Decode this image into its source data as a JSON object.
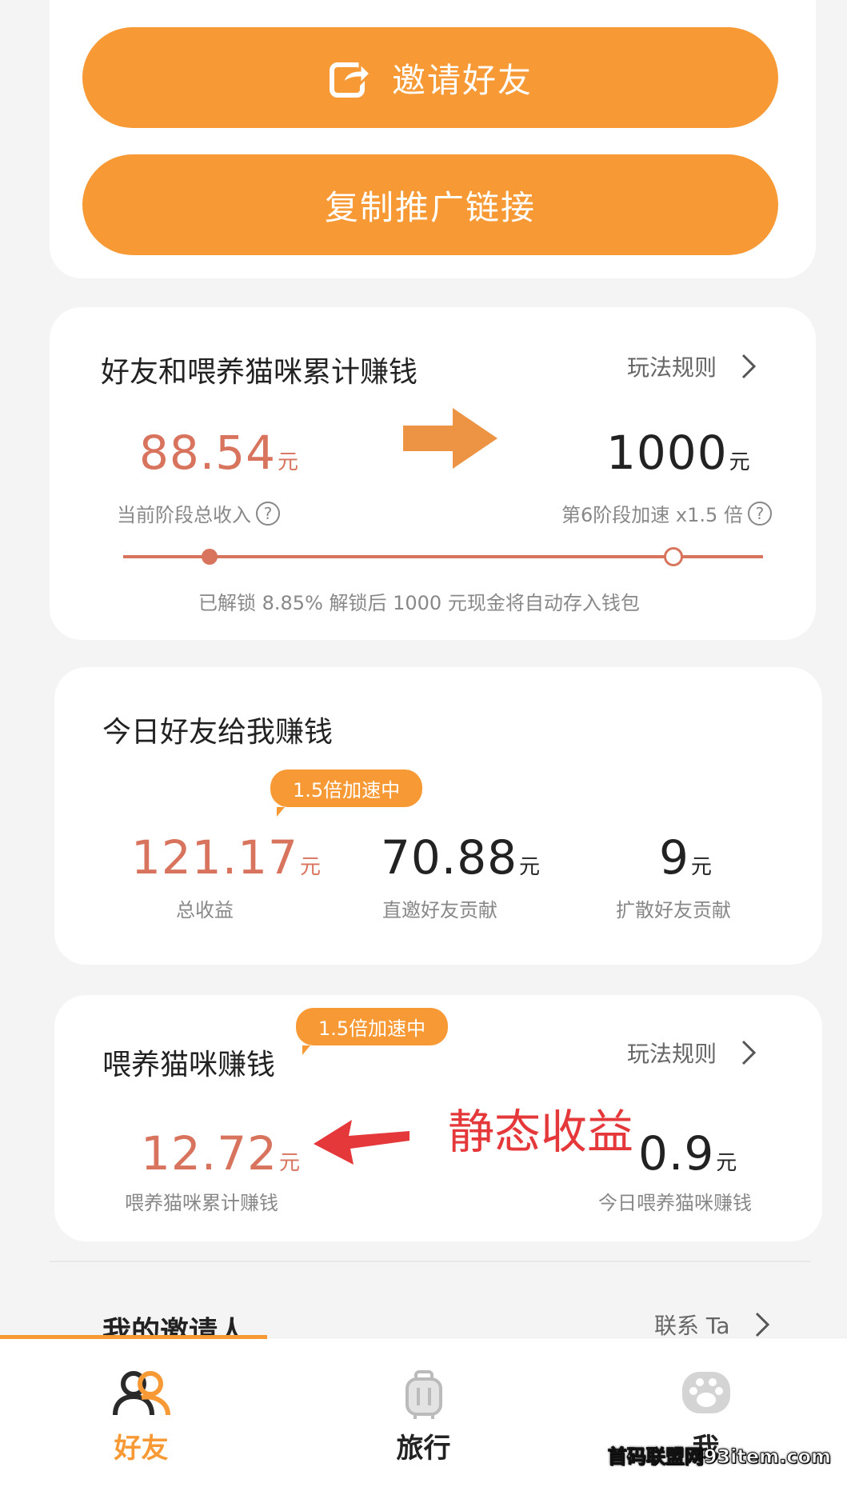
{
  "actions": {
    "invite_label": "邀请好友",
    "copy_link_label": "复制推广链接"
  },
  "cumulative": {
    "title": "好友和喂养猫咪累计赚钱",
    "rules_label": "玩法规则",
    "current_amount": "88.54",
    "current_unit": "元",
    "current_caption": "当前阶段总收入",
    "target_amount": "1000",
    "target_unit": "元",
    "target_caption": "第6阶段加速 x1.5 倍",
    "progress_text": "已解锁 8.85% 解锁后 1000 元现金将自动存入钱包",
    "progress_fraction": 0.0885
  },
  "today_friends": {
    "title": "今日好友给我赚钱",
    "badge": "1.5倍加速中",
    "stats": [
      {
        "value": "121.17",
        "unit": "元",
        "caption": "总收益"
      },
      {
        "value": "70.88",
        "unit": "元",
        "caption": "直邀好友贡献"
      },
      {
        "value": "9",
        "unit": "元",
        "caption": "扩散好友贡献"
      }
    ]
  },
  "cat_feeding": {
    "title": "喂养猫咪赚钱",
    "badge": "1.5倍加速中",
    "rules_label": "玩法规则",
    "total_value": "12.72",
    "total_unit": "元",
    "total_caption": "喂养猫咪累计赚钱",
    "today_value": "0.9",
    "today_unit": "元",
    "today_caption": "今日喂养猫咪赚钱",
    "annotation": "静态收益"
  },
  "inviter": {
    "title": "我的邀请人",
    "contact_label": "联系 Ta"
  },
  "nav": {
    "items": [
      {
        "label": "好友",
        "icon": "friends-icon"
      },
      {
        "label": "旅行",
        "icon": "luggage-icon"
      },
      {
        "label": "我",
        "icon": "paw-icon"
      }
    ]
  },
  "watermark": "首码联盟网93item.com",
  "colors": {
    "accent": "#f79a36",
    "value_red": "#d8735d",
    "annotation_red": "#e5383b"
  }
}
